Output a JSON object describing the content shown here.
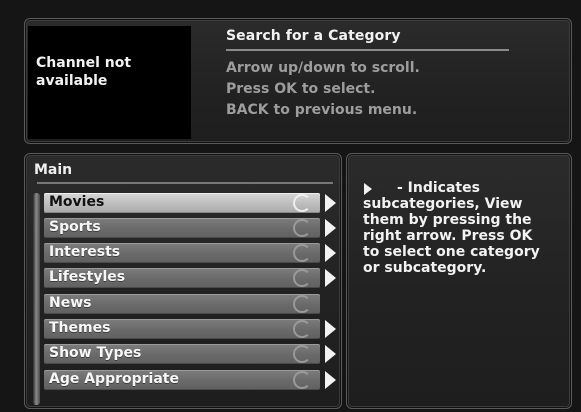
{
  "top_panel": {
    "video_message": "Channel not available",
    "title": "Search for a Category",
    "help_lines": [
      "Arrow up/down to scroll.",
      "Press OK to select.",
      "BACK to previous menu."
    ]
  },
  "menu": {
    "title": "Main",
    "items": [
      {
        "label": "Movies",
        "has_subcategories": true,
        "selected": true
      },
      {
        "label": "Sports",
        "has_subcategories": true,
        "selected": false
      },
      {
        "label": "Interests",
        "has_subcategories": true,
        "selected": false
      },
      {
        "label": "Lifestyles",
        "has_subcategories": true,
        "selected": false
      },
      {
        "label": "News",
        "has_subcategories": false,
        "selected": false
      },
      {
        "label": "Themes",
        "has_subcategories": true,
        "selected": false
      },
      {
        "label": "Show Types",
        "has_subcategories": true,
        "selected": false
      },
      {
        "label": "Age Appropriate",
        "has_subcategories": true,
        "selected": false
      }
    ]
  },
  "info": {
    "lines": [
      "- Indicates",
      "subcategories, View",
      "them by pressing the",
      "right arrow. Press OK",
      "to select one category",
      "or subcategory."
    ]
  },
  "icons": {
    "spinner": "spinner-icon",
    "submenu": "right-arrow-icon"
  }
}
